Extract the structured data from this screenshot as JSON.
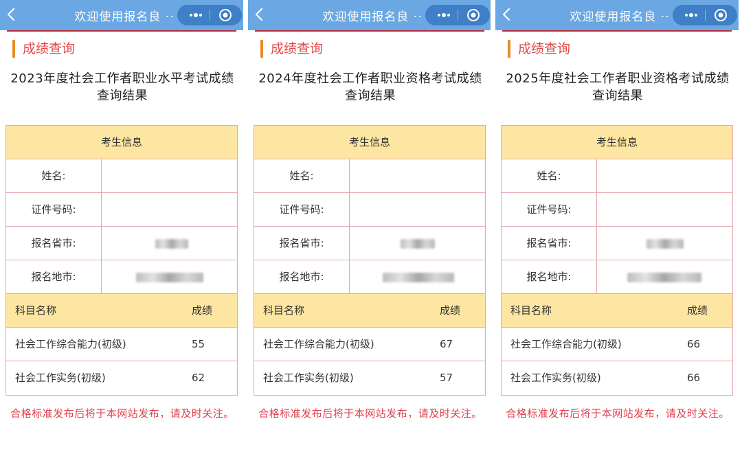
{
  "panels": [
    {
      "nav_title": "欢迎使用报名良 ··",
      "section_title": "成绩查询",
      "headline": "2023年度社会工作者职业水平考试成绩查询结果",
      "info_header": "考生信息",
      "fields": [
        {
          "label": "姓名:",
          "value": ""
        },
        {
          "label": "证件号码:",
          "value": ""
        },
        {
          "label": "报名省市:",
          "value": ""
        },
        {
          "label": "报名地市:",
          "value": ""
        }
      ],
      "subjects_header": {
        "name": "科目名称",
        "score": "成绩"
      },
      "subjects": [
        {
          "name": "社会工作综合能力(初级)",
          "score": "55"
        },
        {
          "name": "社会工作实务(初级)",
          "score": "62"
        }
      ],
      "notice": "合格标准发布后将于本网站发布，请及时关注。"
    },
    {
      "nav_title": "欢迎使用报名良 ··",
      "section_title": "成绩查询",
      "headline": "2024年度社会工作者职业资格考试成绩查询结果",
      "info_header": "考生信息",
      "fields": [
        {
          "label": "姓名:",
          "value": ""
        },
        {
          "label": "证件号码:",
          "value": ""
        },
        {
          "label": "报名省市:",
          "value": ""
        },
        {
          "label": "报名地市:",
          "value": ""
        }
      ],
      "subjects_header": {
        "name": "科目名称",
        "score": "成绩"
      },
      "subjects": [
        {
          "name": "社会工作综合能力(初级)",
          "score": "67"
        },
        {
          "name": "社会工作实务(初级)",
          "score": "57"
        }
      ],
      "notice": "合格标准发布后将于本网站发布，请及时关注。"
    },
    {
      "nav_title": "欢迎使用报名良 ··",
      "section_title": "成绩查询",
      "headline": "2025年度社会工作者职业资格考试成绩查询结果",
      "info_header": "考生信息",
      "fields": [
        {
          "label": "姓名:",
          "value": ""
        },
        {
          "label": "证件号码:",
          "value": ""
        },
        {
          "label": "报名省市:",
          "value": ""
        },
        {
          "label": "报名地市:",
          "value": ""
        }
      ],
      "subjects_header": {
        "name": "科目名称",
        "score": "成绩"
      },
      "subjects": [
        {
          "name": "社会工作综合能力(初级)",
          "score": "66"
        },
        {
          "name": "社会工作实务(初级)",
          "score": "66"
        }
      ],
      "notice": "合格标准发布后将于本网站发布，请及时关注。"
    }
  ],
  "icons": {
    "back": "chevron-left-icon",
    "more": "more-dots-icon",
    "close": "close-target-icon"
  },
  "colors": {
    "nav": "#6aa7e3",
    "capsule": "#3f7fc5",
    "section_bar": "#e98b26",
    "section_text": "#e14848",
    "table_border": "#e9a6ad",
    "header_fill": "#fde6a2",
    "notice": "#e23d4a"
  }
}
